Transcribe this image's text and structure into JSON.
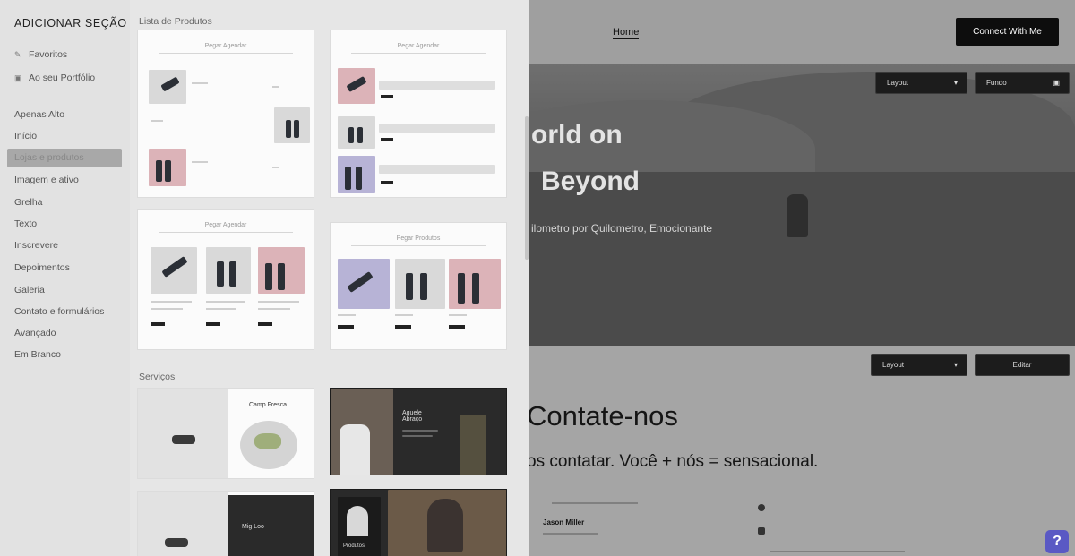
{
  "sidebar": {
    "title": "ADICIONAR SEÇÃO",
    "links": [
      {
        "label": "Favoritos",
        "icon": "bookmark-icon"
      },
      {
        "label": "Ao seu Portfólio",
        "icon": "folder-icon"
      }
    ],
    "categories": [
      "Apenas Alto",
      "Início",
      "Lojas e produtos",
      "Imagem e ativo",
      "Grelha",
      "Texto",
      "Inscrevere",
      "Depoimentos",
      "Galeria",
      "Contato e formulários",
      "Avançado",
      "Em Branco"
    ],
    "active_category": "Lojas e produtos"
  },
  "panel": {
    "section1_label": "Lista de Produtos",
    "section2_label": "Serviços",
    "card_titles": [
      "Pegar Agendar",
      "Pegar Agendar",
      "Pegar Agendar",
      "Pegar Produtos"
    ],
    "service_cards": [
      {
        "title": "Camp Fresca"
      },
      {
        "title": "Aquele Abraço"
      },
      {
        "title": "Mig Loo"
      },
      {
        "title": "Produtos"
      }
    ]
  },
  "preview": {
    "nav_home": "Home",
    "connect_button": "Connect With Me",
    "hero_layout_button": "Layout",
    "hero_fundo_button": "Fundo",
    "hero_line1": "orld on",
    "hero_line2": "Beyond",
    "hero_subtitle": "ilometro por Quilometro, Emocionante",
    "section_layout_button": "Layout",
    "section_edit_button": "Editar",
    "contact_heading": "Contate-nos",
    "contact_subheading": "os contatar. Você + nós = sensacional.",
    "contact_name": "Jason Miller",
    "help_label": "?"
  },
  "colors": {
    "connect_bg": "#0d0d0d",
    "help_bg": "#5a59c4",
    "sidebar_active": "#a8a8a8"
  }
}
